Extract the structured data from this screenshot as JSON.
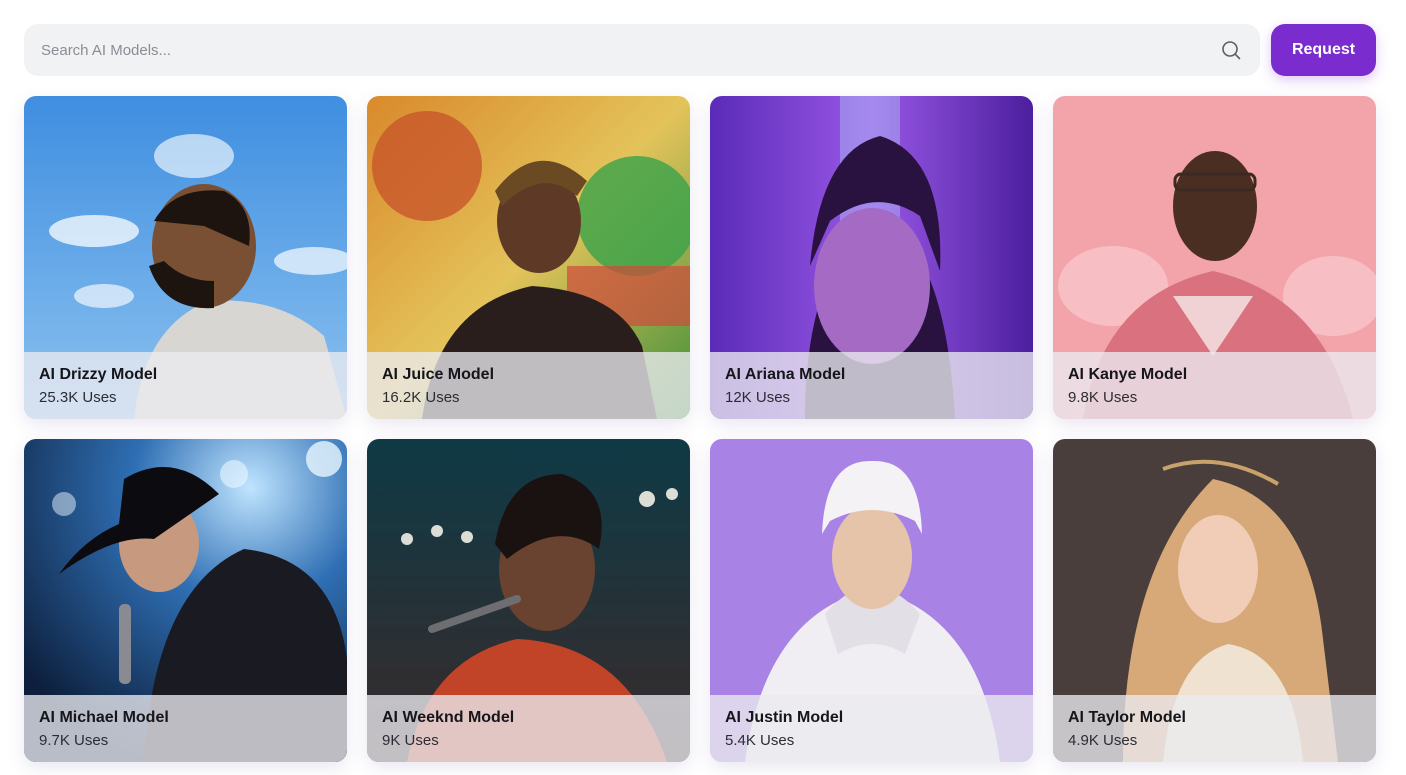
{
  "search": {
    "placeholder": "Search AI Models...",
    "value": "",
    "icon": "search-icon"
  },
  "request_button": {
    "label": "Request",
    "color": "#7b2ccf"
  },
  "models": [
    {
      "title": "AI Drizzy Model",
      "uses": "25.3K Uses"
    },
    {
      "title": "AI Juice Model",
      "uses": "16.2K Uses"
    },
    {
      "title": "AI Ariana Model",
      "uses": "12K Uses"
    },
    {
      "title": "AI Kanye Model",
      "uses": "9.8K Uses"
    },
    {
      "title": "AI Michael Model",
      "uses": "9.7K Uses"
    },
    {
      "title": "AI Weeknd Model",
      "uses": "9K Uses"
    },
    {
      "title": "AI Justin Model",
      "uses": "5.4K Uses"
    },
    {
      "title": "AI Taylor Model",
      "uses": "4.9K Uses"
    }
  ]
}
